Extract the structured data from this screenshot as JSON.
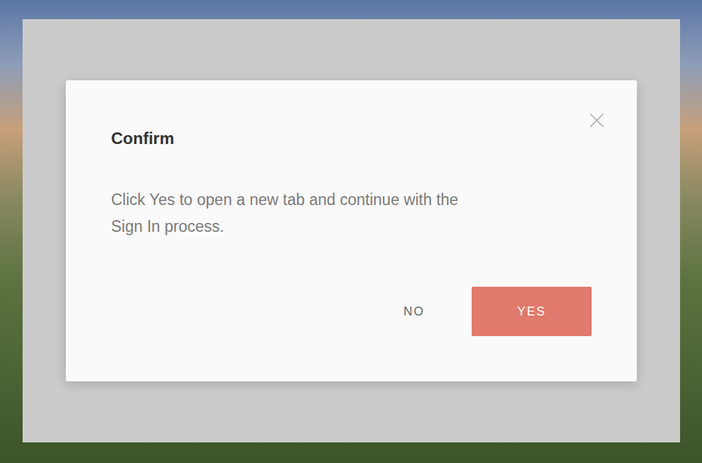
{
  "dialog": {
    "title": "Confirm",
    "message": "Click Yes to open a new tab and continue with the Sign In process.",
    "buttons": [
      {
        "label": "NO",
        "kind": "text"
      },
      {
        "label": "YES",
        "kind": "primary"
      }
    ]
  }
}
